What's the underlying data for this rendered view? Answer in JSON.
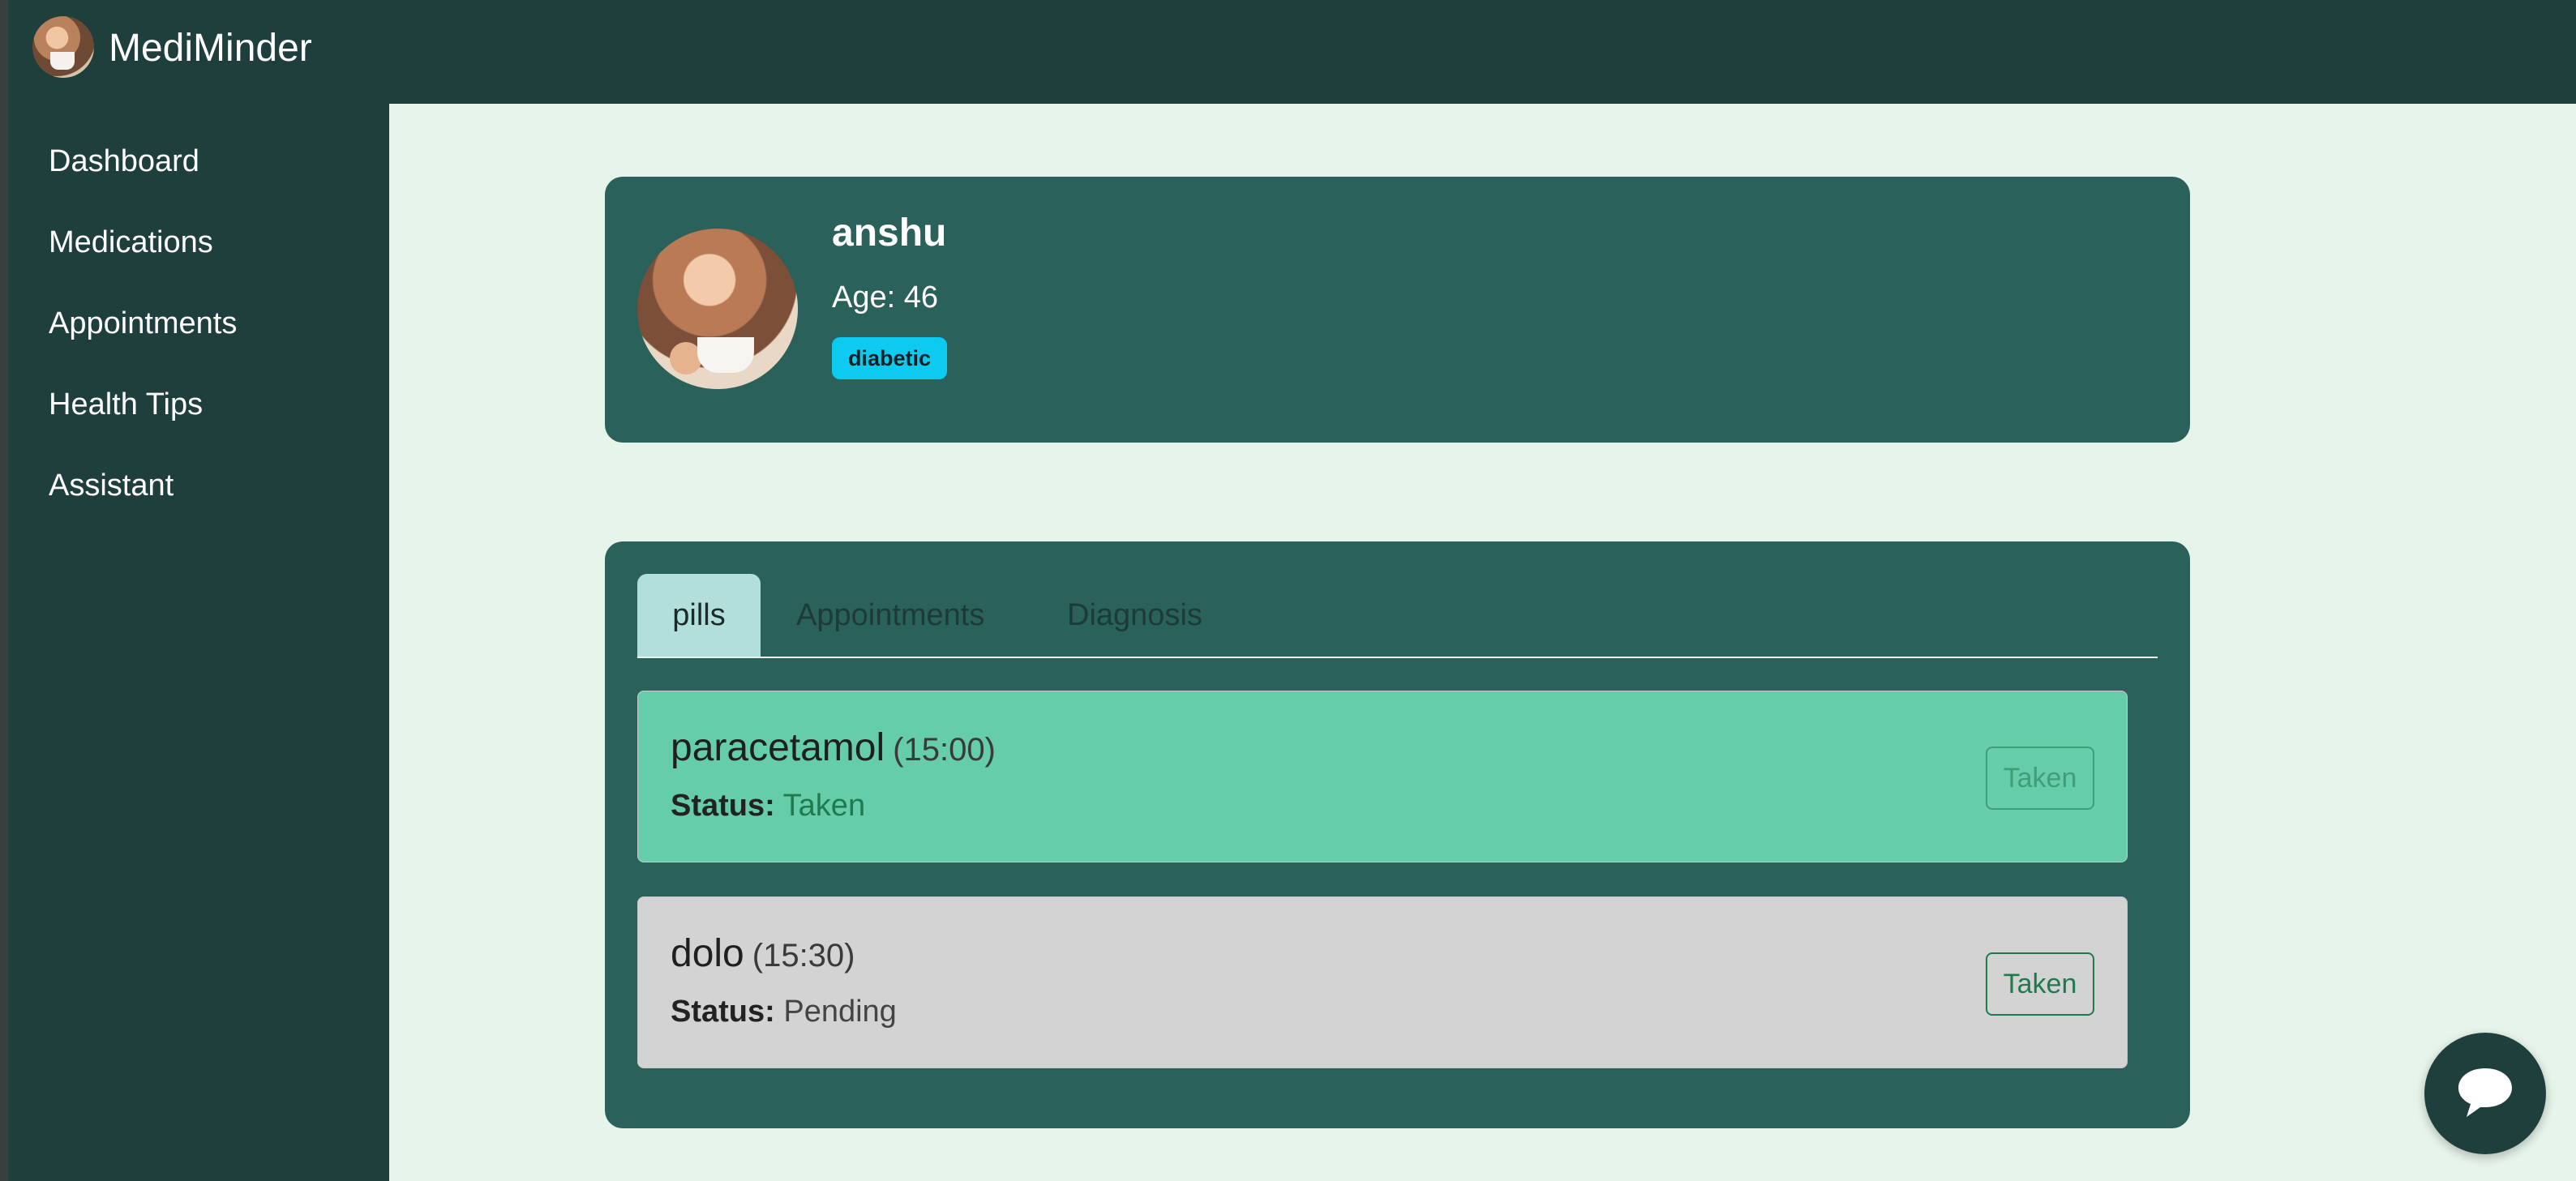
{
  "app": {
    "name": "MediMinder"
  },
  "sidebar": {
    "items": [
      {
        "label": "Dashboard"
      },
      {
        "label": "Medications"
      },
      {
        "label": "Appointments"
      },
      {
        "label": "Health Tips"
      },
      {
        "label": "Assistant"
      }
    ]
  },
  "profile": {
    "name": "anshu",
    "age_text": "Age: 46",
    "badge": "diabetic"
  },
  "tabs": [
    {
      "label": "pills",
      "active": true
    },
    {
      "label": "Appointments",
      "active": false
    },
    {
      "label": "Diagnosis",
      "active": false
    }
  ],
  "pills": [
    {
      "name": "paracetamol",
      "time": "(15:00)",
      "status_label": "Status:",
      "status": "Taken",
      "button": "Taken"
    },
    {
      "name": "dolo",
      "time": "(15:30)",
      "status_label": "Status:",
      "status": "Pending",
      "button": "Taken"
    }
  ],
  "icons": {
    "chat": "chat-bubble-icon",
    "scroll_up": "scroll-up-arrow-icon",
    "scroll_down": "scroll-down-arrow-icon"
  },
  "colors": {
    "sidebar": "#1e3f3c",
    "card": "#2a615b",
    "page_bg": "#e6f4ea",
    "taken_row": "#66cdaa",
    "pending_row": "#d3d3d3",
    "badge": "#0dcaf0"
  }
}
